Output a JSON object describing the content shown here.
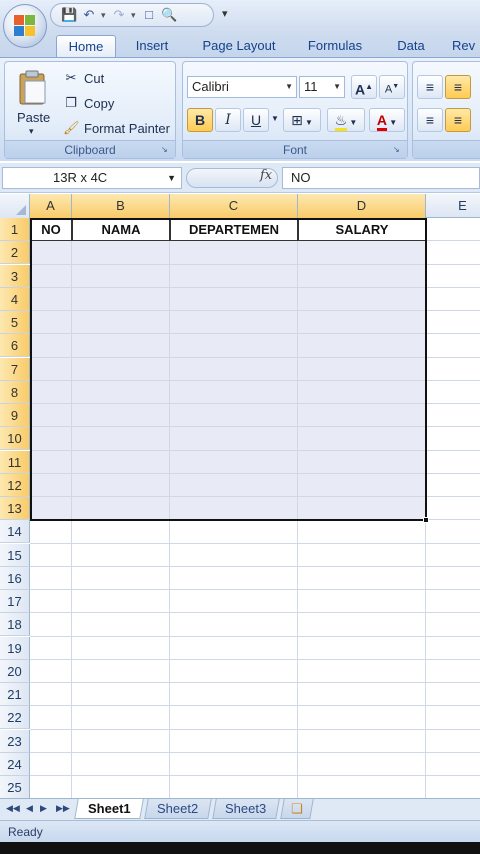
{
  "quick_access": {
    "icons": [
      "save-icon",
      "undo-icon",
      "redo-icon",
      "new-icon",
      "print-preview-icon"
    ],
    "more": "▾"
  },
  "tabs": [
    "Home",
    "Insert",
    "Page Layout",
    "Formulas",
    "Data",
    "Rev"
  ],
  "clipboard": {
    "paste": "Paste",
    "cut": "Cut",
    "copy": "Copy",
    "format_painter": "Format Painter",
    "label": "Clipboard"
  },
  "font": {
    "family": "Calibri",
    "size": "11",
    "bold": "B",
    "italic": "I",
    "underline": "U",
    "label": "Font",
    "grow": "A",
    "shrink": "A",
    "font_color": "A"
  },
  "formula_bar": {
    "name_box": "13R x 4C",
    "fx": "fx",
    "content": "NO"
  },
  "columns": [
    "A",
    "B",
    "C",
    "D",
    "E"
  ],
  "rows": [
    "1",
    "2",
    "3",
    "4",
    "5",
    "6",
    "7",
    "8",
    "9",
    "10",
    "11",
    "12",
    "13",
    "14",
    "15",
    "16",
    "17",
    "18",
    "19",
    "20",
    "21",
    "22",
    "23",
    "24",
    "25"
  ],
  "table": {
    "headers": [
      "NO",
      "NAMA",
      "DEPARTEMEN",
      "SALARY"
    ]
  },
  "sheets": [
    "Sheet1",
    "Sheet2",
    "Sheet3"
  ],
  "status": "Ready",
  "colors": {
    "selection_fill": "#e8ebf6",
    "header_selected": "#f9cb68",
    "ribbon": "#dbe7f7"
  }
}
